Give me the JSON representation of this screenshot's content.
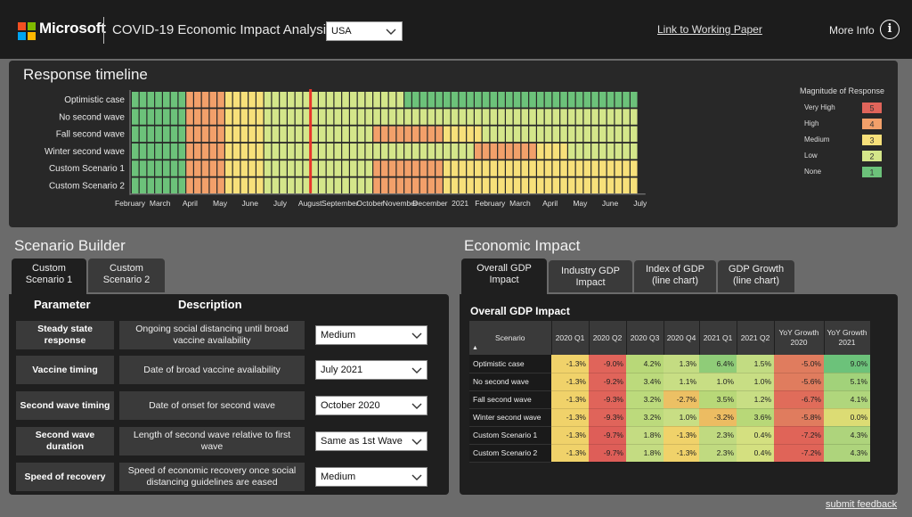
{
  "header": {
    "brand": "Microsoft",
    "title": "COVID-19 Economic Impact Analysis",
    "country_selected": "USA",
    "paper_link": "Link to Working Paper",
    "more_info": "More Info",
    "info_icon": "i",
    "logo_colors": [
      "#f25022",
      "#7fba00",
      "#00a4ef",
      "#ffb900"
    ]
  },
  "timeline": {
    "title": "Response timeline",
    "scenarios": [
      "Optimistic case",
      "No second wave",
      "Fall second wave",
      "Winter second wave",
      "Custom Scenario 1",
      "Custom Scenario 2"
    ],
    "x_labels": [
      "February",
      "March",
      "April",
      "May",
      "June",
      "July",
      "August",
      "September",
      "October",
      "November",
      "December",
      "2021",
      "February",
      "March",
      "April",
      "May",
      "June",
      "July"
    ],
    "today_marker_week": 23,
    "legend_title": "Magnitude of Response",
    "legend": [
      {
        "label": "Very High",
        "value": "5",
        "color": "#e0645a"
      },
      {
        "label": "High",
        "value": "4",
        "color": "#f2a06a"
      },
      {
        "label": "Medium",
        "value": "3",
        "color": "#f7e07a"
      },
      {
        "label": "Low",
        "value": "2",
        "color": "#d4e68a"
      },
      {
        "label": "None",
        "value": "1",
        "color": "#6cc27a"
      }
    ],
    "rows": [
      {
        "segments": [
          [
            7,
            1
          ],
          [
            5,
            4
          ],
          [
            5,
            3
          ],
          [
            18,
            2
          ],
          [
            30,
            1
          ]
        ]
      },
      {
        "segments": [
          [
            7,
            1
          ],
          [
            5,
            4
          ],
          [
            5,
            3
          ],
          [
            48,
            2
          ]
        ]
      },
      {
        "segments": [
          [
            7,
            1
          ],
          [
            5,
            4
          ],
          [
            5,
            3
          ],
          [
            14,
            2
          ],
          [
            9,
            4
          ],
          [
            5,
            3
          ],
          [
            20,
            2
          ]
        ]
      },
      {
        "segments": [
          [
            7,
            1
          ],
          [
            5,
            4
          ],
          [
            5,
            3
          ],
          [
            27,
            2
          ],
          [
            8,
            4
          ],
          [
            4,
            3
          ],
          [
            9,
            2
          ]
        ]
      },
      {
        "segments": [
          [
            7,
            1
          ],
          [
            5,
            4
          ],
          [
            5,
            3
          ],
          [
            14,
            2
          ],
          [
            9,
            4
          ],
          [
            25,
            3
          ]
        ]
      },
      {
        "segments": [
          [
            7,
            1
          ],
          [
            5,
            4
          ],
          [
            5,
            3
          ],
          [
            14,
            2
          ],
          [
            9,
            4
          ],
          [
            25,
            3
          ]
        ]
      }
    ]
  },
  "scenario_builder": {
    "title": "Scenario Builder",
    "tabs": [
      "Custom Scenario 1",
      "Custom Scenario 2"
    ],
    "col_parameter": "Parameter",
    "col_description": "Description",
    "params": [
      {
        "name": "Steady state response",
        "description": "Ongoing social distancing until broad vaccine availability",
        "value": "Medium"
      },
      {
        "name": "Vaccine timing",
        "description": "Date of broad vaccine availability",
        "value": "July 2021"
      },
      {
        "name": "Second wave timing",
        "description": "Date of onset for second wave",
        "value": "October 2020"
      },
      {
        "name": "Second wave duration",
        "description": "Length of second wave relative to first wave",
        "value": "Same as 1st Wave"
      },
      {
        "name": "Speed of recovery",
        "description": "Speed of economic recovery once social distancing guidelines are eased",
        "value": "Medium"
      }
    ]
  },
  "economic_impact": {
    "title": "Economic Impact",
    "tabs": [
      "Overall GDP Impact",
      "Industry GDP Impact",
      "Index of GDP (line chart)",
      "GDP Growth (line chart)"
    ],
    "table_title": "Overall GDP Impact",
    "sort_indicator": "▲",
    "columns": [
      "Scenario",
      "2020 Q1",
      "2020 Q2",
      "2020 Q3",
      "2020 Q4",
      "2021 Q1",
      "2021 Q2",
      "YoY Growth 2020",
      "YoY Growth 2021"
    ],
    "rows": [
      {
        "scenario": "Optimistic case",
        "values": [
          "-1.3%",
          "-9.0%",
          "4.2%",
          "1.3%",
          "6.4%",
          "1.5%",
          "-5.0%",
          "9.0%"
        ],
        "colors": [
          "#f0d26a",
          "#e0645a",
          "#b8d878",
          "#c4dc82",
          "#8fcc78",
          "#c2dc82",
          "#e07c5e",
          "#6cc27a"
        ]
      },
      {
        "scenario": "No second wave",
        "values": [
          "-1.3%",
          "-9.2%",
          "3.4%",
          "1.1%",
          "1.0%",
          "1.0%",
          "-5.6%",
          "5.1%"
        ],
        "colors": [
          "#f0d26a",
          "#e0645a",
          "#bcda7c",
          "#c8de84",
          "#c8de84",
          "#c8de84",
          "#e07c5e",
          "#a2d27a"
        ]
      },
      {
        "scenario": "Fall second wave",
        "values": [
          "-1.3%",
          "-9.3%",
          "3.2%",
          "-2.7%",
          "3.5%",
          "1.2%",
          "-6.7%",
          "4.1%"
        ],
        "colors": [
          "#f0d26a",
          "#e0645a",
          "#bcda7c",
          "#ecc064",
          "#b8d878",
          "#c8de84",
          "#e06c5a",
          "#b0d67c"
        ]
      },
      {
        "scenario": "Winter second wave",
        "values": [
          "-1.3%",
          "-9.3%",
          "3.2%",
          "1.0%",
          "-3.2%",
          "3.6%",
          "-5.8%",
          "0.0%"
        ],
        "colors": [
          "#f0d26a",
          "#e0645a",
          "#bcda7c",
          "#c8de84",
          "#ecbc62",
          "#b8d878",
          "#e07c5e",
          "#dcdc74"
        ]
      },
      {
        "scenario": "Custom Scenario 1",
        "values": [
          "-1.3%",
          "-9.7%",
          "1.8%",
          "-1.3%",
          "2.3%",
          "0.4%",
          "-7.2%",
          "4.3%"
        ],
        "colors": [
          "#f0d26a",
          "#de5e58",
          "#c4dc82",
          "#f0d26a",
          "#c0da80",
          "#d4e080",
          "#e06458",
          "#aed47c"
        ]
      },
      {
        "scenario": "Custom Scenario 2",
        "values": [
          "-1.3%",
          "-9.7%",
          "1.8%",
          "-1.3%",
          "2.3%",
          "0.4%",
          "-7.2%",
          "4.3%"
        ],
        "colors": [
          "#f0d26a",
          "#de5e58",
          "#c4dc82",
          "#f0d26a",
          "#c0da80",
          "#d4e080",
          "#e06458",
          "#aed47c"
        ]
      }
    ]
  },
  "footer": {
    "feedback": "submit feedback"
  }
}
